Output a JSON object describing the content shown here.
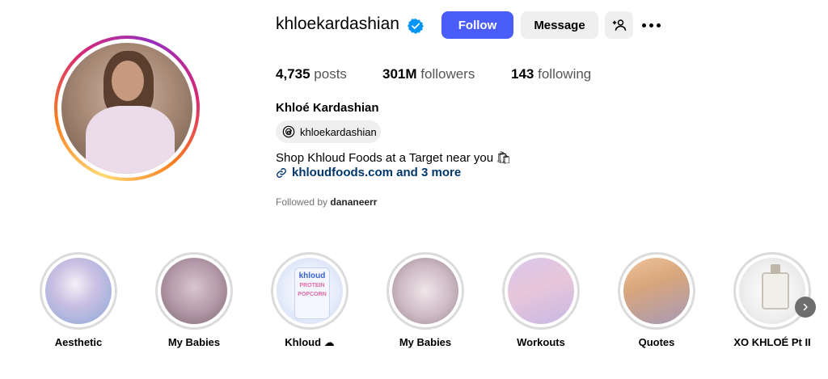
{
  "profile": {
    "username": "khloekardashian",
    "full_name": "Khloé Kardashian",
    "threads_handle": "khloekardashian",
    "bio": "Shop Khloud Foods at a Target near you",
    "bio_emoji": "🛍",
    "link_text": "khloudfoods.com and 3 more",
    "followed_by_label": "Followed by",
    "followed_by_user": "dananeerr"
  },
  "buttons": {
    "follow": "Follow",
    "message": "Message"
  },
  "stats": {
    "posts_count": "4,735",
    "posts_label": "posts",
    "followers_count": "301M",
    "followers_label": "followers",
    "following_count": "143",
    "following_label": "following"
  },
  "highlights": [
    {
      "label": "Aesthetic"
    },
    {
      "label": "My Babies"
    },
    {
      "label": "Khloud ☁"
    },
    {
      "label": "My Babies"
    },
    {
      "label": "Workouts"
    },
    {
      "label": "Quotes"
    },
    {
      "label": "XO KHLOÉ Pt II"
    }
  ],
  "khloud_pack": {
    "brand": "khloud",
    "line1": "PROTEIN",
    "line2": "POPCORN"
  },
  "icons": [
    "verified-badge-icon",
    "add-user-icon",
    "more-options-icon",
    "threads-icon",
    "link-icon",
    "chevron-right-icon"
  ],
  "colors": {
    "follow_button": "#4a5df9",
    "link": "#00376b",
    "verified": "#0095f6"
  }
}
